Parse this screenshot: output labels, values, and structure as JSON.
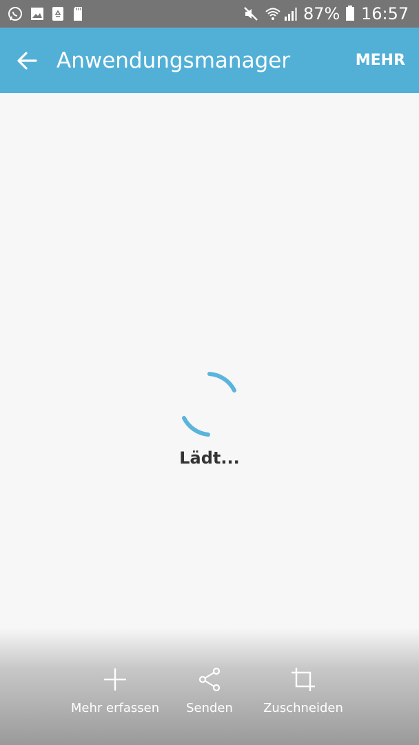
{
  "status_bar": {
    "battery_percent": "87%",
    "time": "16:57",
    "left_icons": [
      "whatsapp-icon",
      "gallery-icon",
      "recycle-icon",
      "sd-card-icon"
    ],
    "right_icons": [
      "mute-icon",
      "wifi-icon",
      "signal-icon",
      "battery-icon"
    ]
  },
  "app_bar": {
    "title": "Anwendungsmanager",
    "more_label": "MEHR",
    "back_icon": "back-arrow-icon",
    "color": "#52b0d7"
  },
  "content": {
    "loading_text": "Lädt...",
    "spinner_color": "#5ab4dc"
  },
  "bottom_actions": [
    {
      "label": "Mehr erfassen",
      "icon": "plus-icon"
    },
    {
      "label": "Senden",
      "icon": "share-icon"
    },
    {
      "label": "Zuschneiden",
      "icon": "crop-icon"
    }
  ]
}
